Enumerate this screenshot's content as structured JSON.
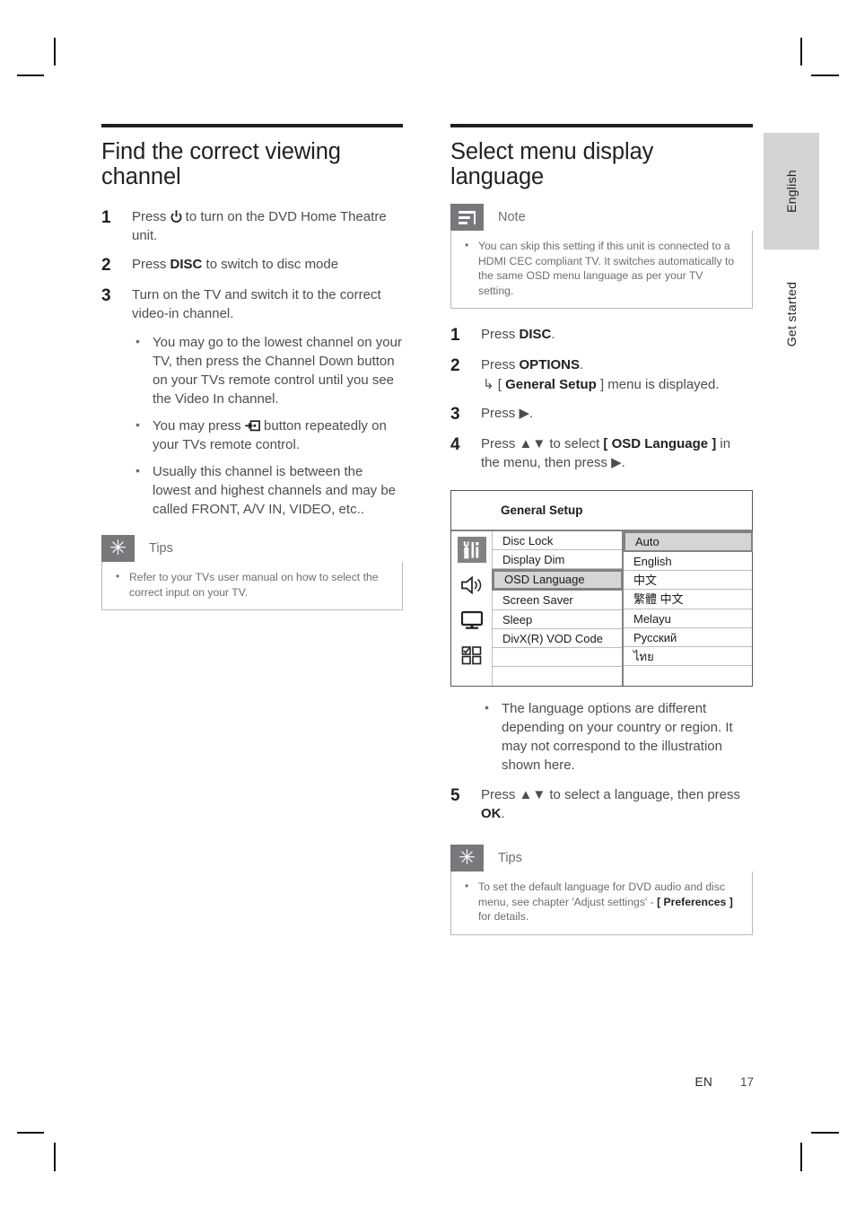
{
  "page": {
    "footer_lang": "EN",
    "footer_page": "17",
    "side_tab_language": "English",
    "side_tab_chapter": "Get started"
  },
  "left_column": {
    "title": "Find the correct viewing channel",
    "steps": [
      {
        "num": "1",
        "text_before": "Press ",
        "icon": "power-icon",
        "text_after": " to turn on the DVD Home Theatre unit."
      },
      {
        "num": "2",
        "text_before": "Press ",
        "bold": "DISC",
        "text_after": " to switch to disc mode"
      },
      {
        "num": "3",
        "text_before": "Turn on the TV and switch it to the correct video-in channel."
      }
    ],
    "bullets": [
      "You may go to the lowest channel on your TV, then press the Channel Down button on your TVs remote control until you see the Video In channel.",
      "You may press  button repeatedly on your TVs remote control.",
      "Usually this channel is between the lowest and highest channels and may be called FRONT, A/V IN, VIDEO, etc.."
    ],
    "bullet2_before": "You may press ",
    "bullet2_icon": "av-input-icon",
    "bullet2_after": " button repeatedly on your TVs remote control.",
    "tips": {
      "label": "Tips",
      "icon": "asterisk-icon",
      "items": [
        "Refer to your TVs user manual on how to select the correct input on your TV."
      ]
    }
  },
  "right_column": {
    "title": "Select menu display language",
    "note": {
      "label": "Note",
      "icon": "note-lines-icon",
      "items": [
        "You can skip this setting if this unit is connected to a HDMI CEC compliant TV.  It switches automatically to the same OSD menu language as per your TV setting."
      ]
    },
    "steps": [
      {
        "num": "1",
        "text_before": "Press ",
        "bold": "DISC",
        "text_after": "."
      },
      {
        "num": "2",
        "text_before": "Press ",
        "bold": "OPTIONS",
        "text_after": ".",
        "sub_arrow": "↳",
        "sub_before": " [ ",
        "sub_bold": "General Setup",
        "sub_after": " ] menu is displayed."
      },
      {
        "num": "3",
        "text_before": "Press ▶."
      },
      {
        "num": "4",
        "text_before": "Press ▲▼ to select ",
        "bold": "[ OSD Language ]",
        "text_after": " in the menu, then press ▶."
      },
      {
        "num": "5",
        "text_before": "Press ▲▼ to select a language, then press ",
        "bold": "OK",
        "text_after": "."
      }
    ],
    "osd_figure": {
      "title": "General Setup",
      "icons": [
        {
          "name": "tools-icon",
          "selected": true
        },
        {
          "name": "speaker-icon",
          "selected": false
        },
        {
          "name": "tv-monitor-icon",
          "selected": false
        },
        {
          "name": "preferences-grid-icon",
          "selected": false
        }
      ],
      "menu_items": [
        {
          "label": "Disc Lock",
          "selected": false
        },
        {
          "label": "Display Dim",
          "selected": false
        },
        {
          "label": "OSD Language",
          "selected": true
        },
        {
          "label": "Screen Saver",
          "selected": false
        },
        {
          "label": "Sleep",
          "selected": false
        },
        {
          "label": "DivX(R) VOD Code",
          "selected": false
        }
      ],
      "language_options": [
        {
          "label": "Auto",
          "selected": true
        },
        {
          "label": "English",
          "selected": false
        },
        {
          "label": "中文",
          "selected": false
        },
        {
          "label": "繁體 中文",
          "selected": false
        },
        {
          "label": "Melayu",
          "selected": false
        },
        {
          "label": "Русский",
          "selected": false
        },
        {
          "label": "ไทย",
          "selected": false
        }
      ]
    },
    "after_figure_bullets": [
      "The language options are different depending on your country or region. It may not correspond to the illustration shown here."
    ],
    "tips": {
      "label": "Tips",
      "icon": "asterisk-icon",
      "items_parts": {
        "before": "To set the default language for DVD audio and disc menu, see chapter 'Adjust settings' - ",
        "bold": "[ Preferences ]",
        "after": " for details."
      }
    }
  },
  "colors": {
    "rule": "#231f20",
    "body_text": "#4d4d4f",
    "callout_icon_bg": "#77787b",
    "callout_border": "#b9babc",
    "osd_highlight": "#d4d5d7",
    "osd_border": "#808285",
    "side_tab_bg": "#d1d3d4"
  }
}
